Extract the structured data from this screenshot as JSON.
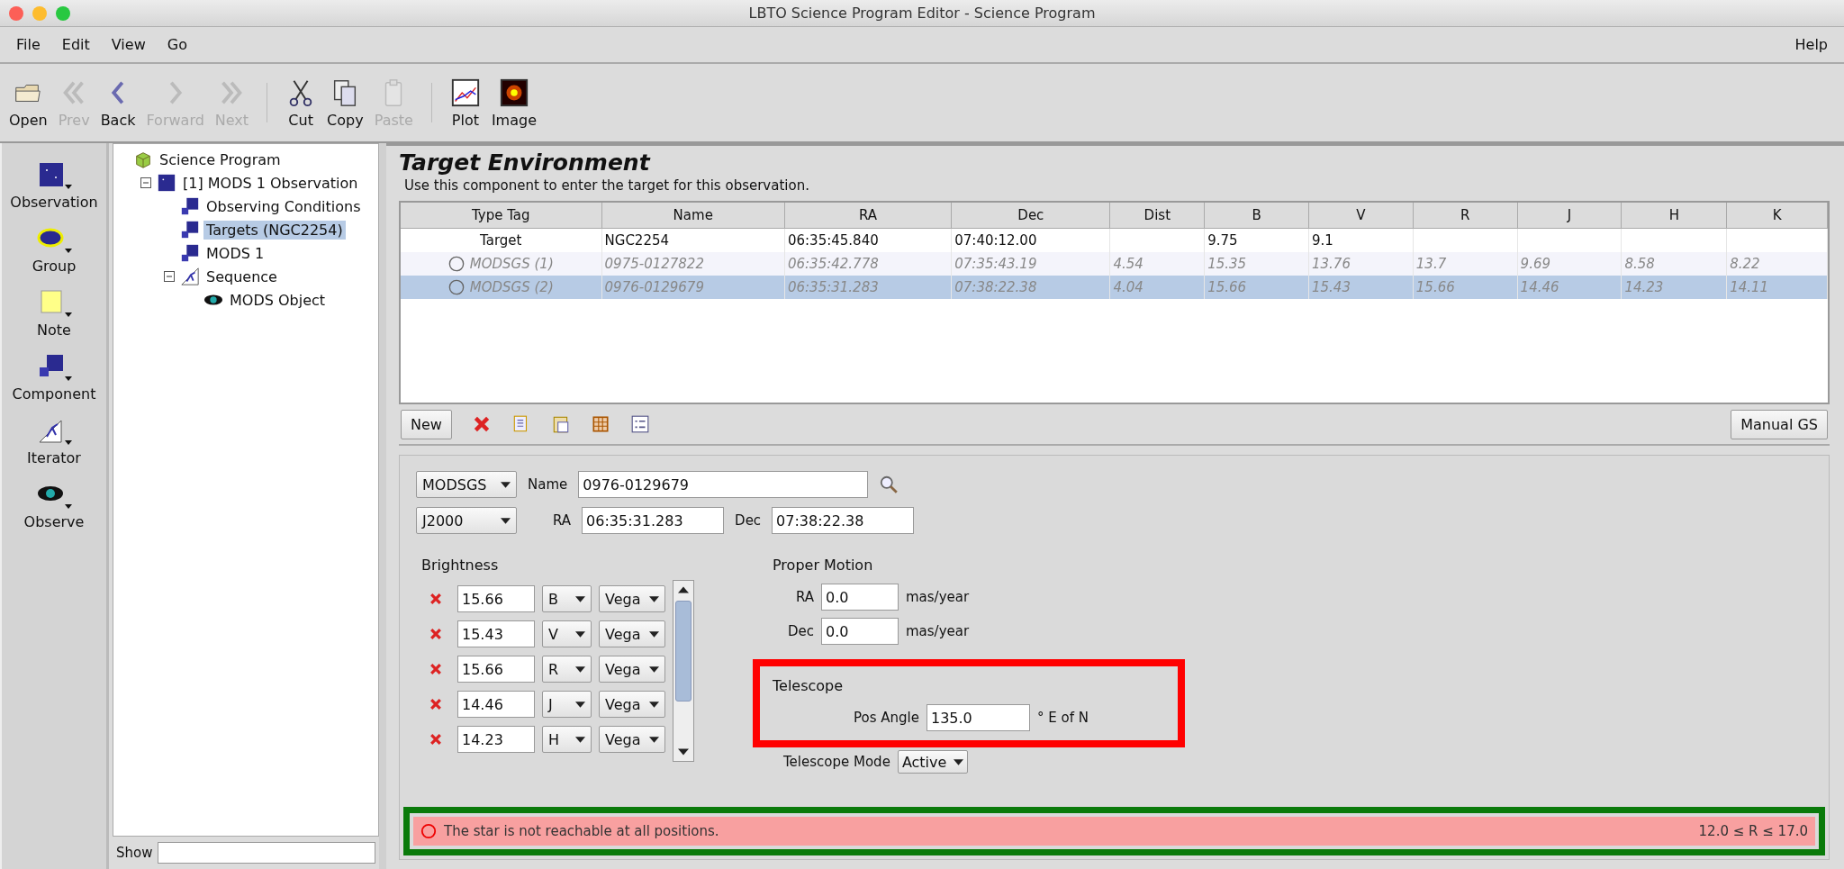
{
  "window": {
    "title": "LBTO Science Program Editor - Science Program"
  },
  "menu": {
    "left": [
      "File",
      "Edit",
      "View",
      "Go"
    ],
    "right": [
      "Help"
    ]
  },
  "toolbar": [
    [
      {
        "label": "Open",
        "kind": "folder",
        "disabled": false
      },
      {
        "label": "Prev",
        "kind": "double-left",
        "disabled": true
      },
      {
        "label": "Back",
        "kind": "left",
        "disabled": false
      },
      {
        "label": "Forward",
        "kind": "right",
        "disabled": true
      },
      {
        "label": "Next",
        "kind": "double-right",
        "disabled": true
      }
    ],
    [
      {
        "label": "Cut",
        "kind": "scissors",
        "disabled": false
      },
      {
        "label": "Copy",
        "kind": "copy",
        "disabled": false
      },
      {
        "label": "Paste",
        "kind": "clipboard",
        "disabled": true
      }
    ],
    [
      {
        "label": "Plot",
        "kind": "plot",
        "disabled": false
      },
      {
        "label": "Image",
        "kind": "image",
        "disabled": false
      }
    ]
  ],
  "palette": [
    {
      "label": "Observation",
      "kind": "observation"
    },
    {
      "label": "Group",
      "kind": "group"
    },
    {
      "label": "Note",
      "kind": "note"
    },
    {
      "label": "Component",
      "kind": "component"
    },
    {
      "label": "Iterator",
      "kind": "iterator"
    },
    {
      "label": "Observe",
      "kind": "observe"
    }
  ],
  "tree": {
    "label": "Science Program",
    "kind": "program",
    "selected": false,
    "children": [
      {
        "label": "[1] MODS 1 Observation",
        "kind": "observation",
        "selected": false,
        "expanded": true,
        "children": [
          {
            "label": "Observing Conditions",
            "kind": "component",
            "selected": false
          },
          {
            "label": "Targets (NGC2254)",
            "kind": "component",
            "selected": true
          },
          {
            "label": "MODS 1",
            "kind": "component",
            "selected": false
          },
          {
            "label": "Sequence",
            "kind": "iterator",
            "selected": false,
            "expanded": true,
            "children": [
              {
                "label": "MODS Object",
                "kind": "observe",
                "selected": false
              }
            ]
          }
        ]
      }
    ]
  },
  "tree_filter": {
    "label": "Show"
  },
  "target_environment": {
    "title": "Target Environment",
    "description": "Use this component to enter the target for this observation.",
    "table": {
      "columns": [
        "Type Tag",
        "Name",
        "RA",
        "Dec",
        "Dist",
        "B",
        "V",
        "R",
        "J",
        "H",
        "K"
      ],
      "rows": [
        {
          "kind": "target",
          "selected": false,
          "cells": [
            "Target",
            "NGC2254",
            "06:35:45.840",
            "07:40:12.00",
            null,
            "9.75",
            "9.1",
            null,
            null,
            null,
            null
          ]
        },
        {
          "kind": "guide",
          "selected": false,
          "cells": [
            "MODSGS (1)",
            "0975-0127822",
            "06:35:42.778",
            "07:35:43.19",
            "4.54",
            "15.35",
            "13.76",
            "13.7",
            "9.69",
            "8.58",
            "8.22"
          ]
        },
        {
          "kind": "guide",
          "selected": true,
          "cells": [
            "MODSGS (2)",
            "0976-0129679",
            "06:35:31.283",
            "07:38:22.38",
            "4.04",
            "15.66",
            "15.43",
            "15.66",
            "14.46",
            "14.23",
            "14.11"
          ]
        }
      ]
    },
    "new_button": "New",
    "manual_button": "Manual GS"
  },
  "form": {
    "type": "MODSGS",
    "name_label": "Name",
    "name": "0976-0129679",
    "system": "J2000",
    "ra_label": "RA",
    "ra": "06:35:31.283",
    "dec_label": "Dec",
    "dec": "07:38:22.38",
    "brightness": {
      "heading": "Brightness",
      "rows": [
        {
          "value": "15.66",
          "band": "B",
          "system": "Vega"
        },
        {
          "value": "15.43",
          "band": "V",
          "system": "Vega"
        },
        {
          "value": "15.66",
          "band": "R",
          "system": "Vega"
        },
        {
          "value": "14.46",
          "band": "J",
          "system": "Vega"
        },
        {
          "value": "14.23",
          "band": "H",
          "system": "Vega"
        }
      ]
    },
    "proper_motion": {
      "heading": "Proper Motion",
      "rows": [
        {
          "label": "RA",
          "value": "0.0",
          "unit": "mas/year"
        },
        {
          "label": "Dec",
          "value": "0.0",
          "unit": "mas/year"
        }
      ]
    },
    "telescope": {
      "heading": "Telescope",
      "pos_angle_label": "Pos Angle",
      "pos_angle": "135.0",
      "pos_angle_unit": "° E of N",
      "mode_label": "Telescope Mode",
      "mode": "Active"
    }
  },
  "status": {
    "message": "The star is not reachable at all positions.",
    "range": "12.0 ≤ R ≤ 17.0"
  }
}
